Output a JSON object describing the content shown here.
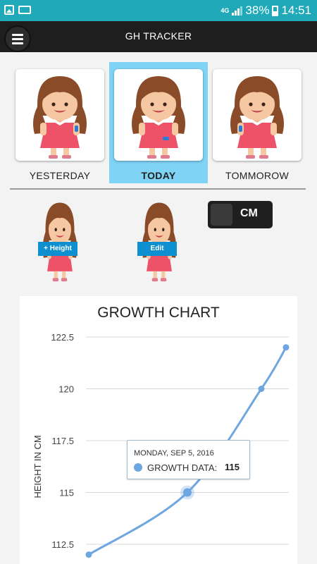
{
  "status": {
    "network": "4G",
    "battery": "38%",
    "time": "14:51"
  },
  "app": {
    "title": "GH TRACKER"
  },
  "days": [
    {
      "label": "YESTERDAY",
      "selected": false
    },
    {
      "label": "TODAY",
      "selected": true
    },
    {
      "label": "TOMMOROW",
      "selected": false
    }
  ],
  "actions": {
    "add_height": "+ Height",
    "edit": "Edit"
  },
  "unit_toggle": {
    "label": "CM"
  },
  "colors": {
    "status_bar": "#20a9b8",
    "toolbar": "#1e1e1e",
    "selected_day": "#7fd3f5",
    "line": "#6ea6e0",
    "action_label": "#0d8fd0"
  },
  "chart_data": {
    "type": "line",
    "title": "GROWTH CHART",
    "ylabel": "HEIGHT IN CM",
    "ylim": [
      112.5,
      122.5
    ],
    "yticks": [
      "122.5",
      "120",
      "117.5",
      "115",
      "112.5"
    ],
    "grid": true,
    "series": [
      {
        "values": [
          112,
          115,
          120,
          122
        ]
      }
    ],
    "tooltip": {
      "date": "MONDAY, SEP 5, 2016",
      "label": "GROWTH DATA:",
      "value": "115"
    }
  }
}
